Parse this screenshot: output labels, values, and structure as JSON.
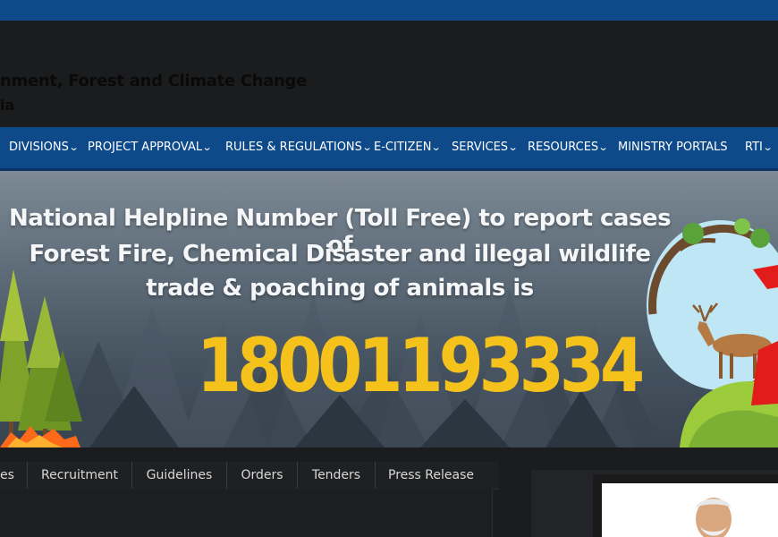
{
  "header": {
    "org_name": "nment, Forest and Climate Change",
    "org_sub": "ia"
  },
  "nav": {
    "items": [
      {
        "label": "DIVISIONS",
        "has_dropdown": true
      },
      {
        "label": "PROJECT APPROVAL",
        "has_dropdown": true
      },
      {
        "label": "RULES & REGULATIONS",
        "has_dropdown": true
      },
      {
        "label": "E-CITIZEN",
        "has_dropdown": true
      },
      {
        "label": "SERVICES",
        "has_dropdown": true
      },
      {
        "label": "RESOURCES",
        "has_dropdown": true
      },
      {
        "label": "MINISTRY PORTALS",
        "has_dropdown": false
      },
      {
        "label": "RTI",
        "has_dropdown": true
      }
    ],
    "chevron_glyph": "⌄"
  },
  "banner": {
    "line1": "National Helpline Number (Toll Free) to report cases of",
    "line2": "Forest Fire, Chemical Disaster and illegal wildlife",
    "line3": "trade & poaching of animals is",
    "number": "18001193334"
  },
  "tabs": [
    "es",
    "Recruitment",
    "Guidelines",
    "Orders",
    "Tenders",
    "Press Release"
  ],
  "colors": {
    "nav_bg": "#0e4a8a",
    "helpline_yellow": "#f5c21b",
    "page_bg": "#1b1c1e"
  }
}
